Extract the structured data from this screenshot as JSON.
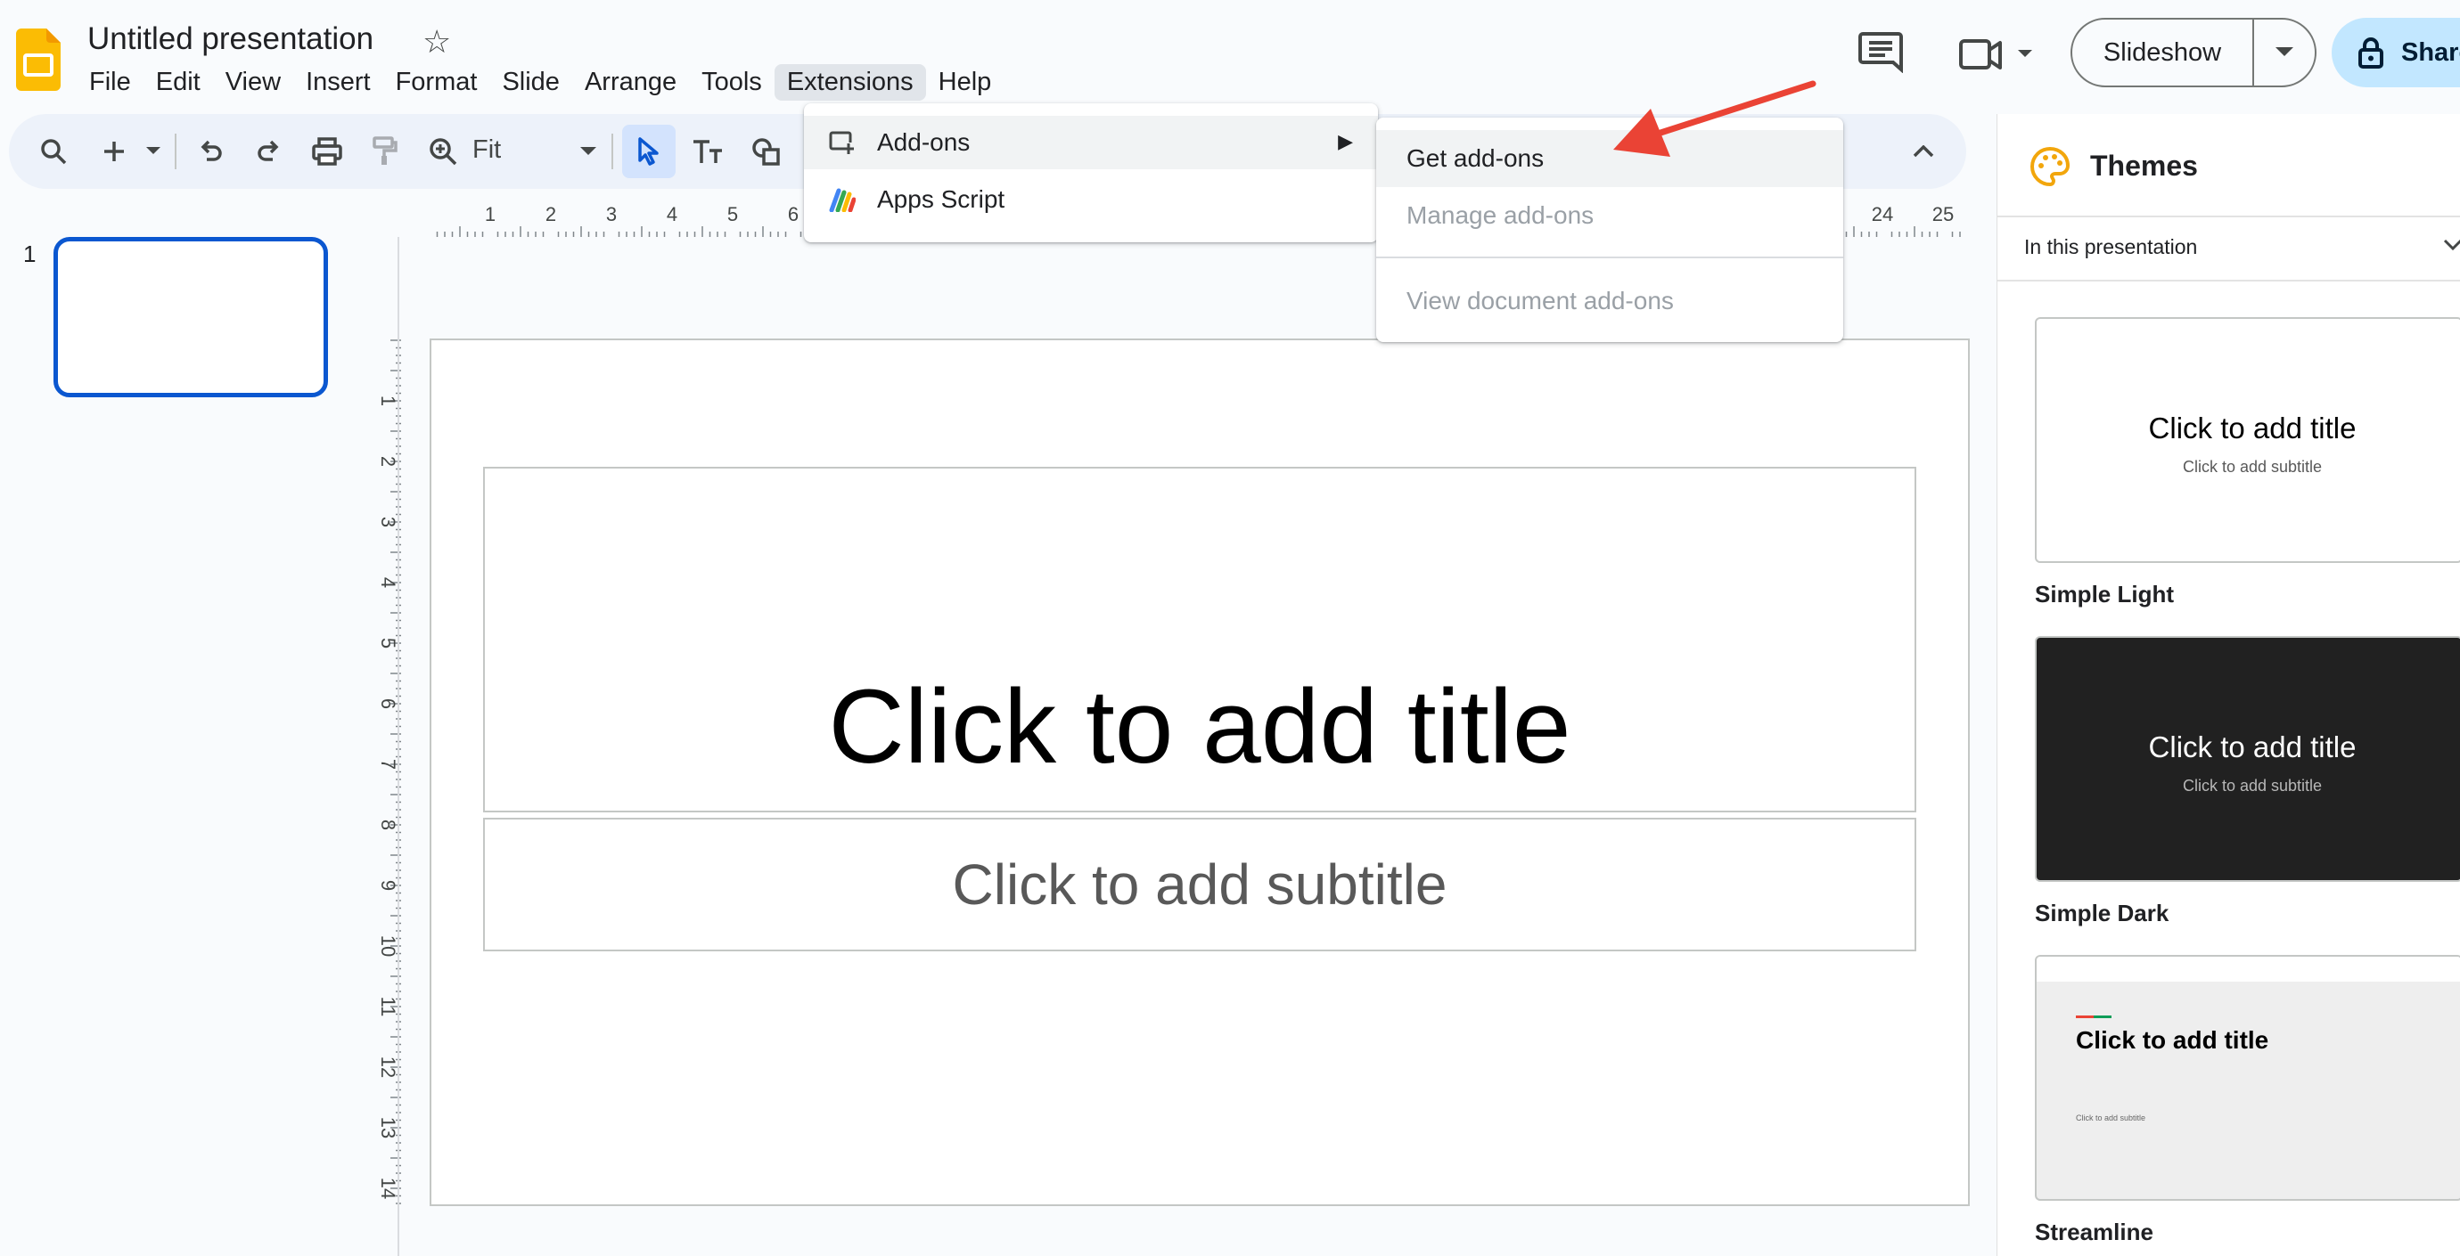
{
  "app": {
    "doc_title": "Untitled presentation",
    "brand_color": "#fbbc04",
    "accent_color": "#0b57d0"
  },
  "menubar": {
    "items": [
      "File",
      "Edit",
      "View",
      "Insert",
      "Format",
      "Slide",
      "Arrange",
      "Tools",
      "Extensions",
      "Help"
    ],
    "active": "Extensions"
  },
  "header": {
    "slideshow_label": "Slideshow",
    "share_label": "Share"
  },
  "toolbar": {
    "zoom_value": "Fit"
  },
  "filmstrip": {
    "slide_number": "1"
  },
  "rulers": {
    "horizontal_left": [
      "1",
      "2",
      "3",
      "4",
      "5",
      "6"
    ],
    "horizontal_right": [
      "24",
      "25"
    ],
    "vertical": [
      "1",
      "2",
      "3",
      "4",
      "5",
      "6",
      "7",
      "8",
      "9",
      "10",
      "11",
      "12",
      "13",
      "14"
    ]
  },
  "slide": {
    "title_placeholder": "Click to add title",
    "subtitle_placeholder": "Click to add subtitle"
  },
  "extensions_menu": {
    "addons_label": "Add-ons",
    "apps_script_label": "Apps Script"
  },
  "addons_submenu": {
    "get_label": "Get add-ons",
    "manage_label": "Manage add-ons",
    "view_label": "View document add-ons"
  },
  "themes": {
    "panel_title": "Themes",
    "filter_label": "In this presentation",
    "items": [
      {
        "name": "Simple Light",
        "title": "Click to add title",
        "subtitle": "Click to add subtitle"
      },
      {
        "name": "Simple Dark",
        "title": "Click to add title",
        "subtitle": "Click to add subtitle"
      },
      {
        "name": "Streamline",
        "title": "Click to add title",
        "subtitle": "Click to add subtitle"
      }
    ]
  },
  "annotation_color": "#ea4335"
}
